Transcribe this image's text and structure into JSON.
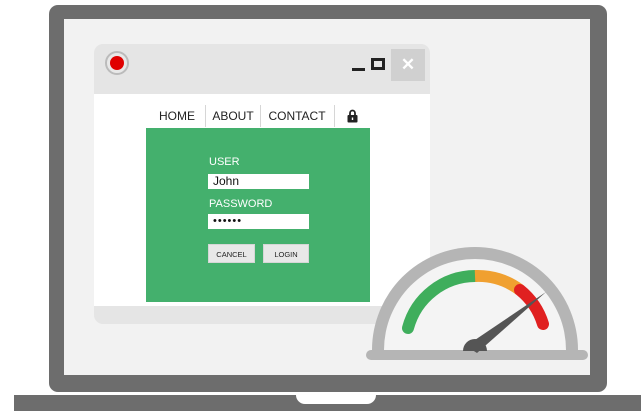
{
  "nav": {
    "items": [
      "HOME",
      "ABOUT",
      "CONTACT"
    ],
    "lock_icon": "lock-icon"
  },
  "login": {
    "user_label": "USER",
    "user_value": "John",
    "password_label": "PASSWORD",
    "password_value": "••••••",
    "cancel_label": "CANCEL",
    "login_label": "LOGIN"
  },
  "window_controls": {
    "close_glyph": "✕"
  },
  "gauge": {
    "segment_colors": [
      "#3fae5c",
      "#f0a030",
      "#e02020"
    ],
    "needle_level_percent": 82
  },
  "colors": {
    "panel_green": "#44b06d",
    "laptop_frame": "#6d6d6d",
    "record_red": "#e00000"
  }
}
